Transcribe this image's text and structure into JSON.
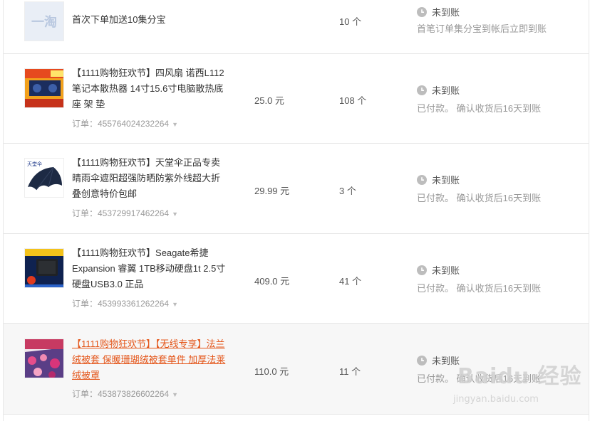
{
  "items": [
    {
      "title": "首次下单加送10集分宝",
      "order": "",
      "price": "",
      "quantity": "10 个",
      "status": "未到账",
      "status_note": "首笔订单集分宝到帐后立即到账",
      "thumb": "taobao-logo"
    },
    {
      "title": "【1111购物狂欢节】四风扇 诺西L112 笔记本散热器 14寸15.6寸电脑散热底座 架 垫",
      "order": "订单：455764024232264",
      "price": "25.0 元",
      "quantity": "108 个",
      "status": "未到账",
      "status_note": "已付款。 确认收货后16天到账",
      "thumb": "laptop-cooler"
    },
    {
      "title": "【1111购物狂欢节】天堂伞正品专卖晴雨伞遮阳超强防晒防紫外线超大折叠创意特价包邮",
      "order": "订单：453729917462264",
      "price": "29.99 元",
      "quantity": "3 个",
      "status": "未到账",
      "status_note": "已付款。 确认收货后16天到账",
      "thumb": "umbrella"
    },
    {
      "title": "【1111购物狂欢节】Seagate希捷 Expansion 睿翼 1TB移动硬盘1t 2.5寸硬盘USB3.0 正品",
      "order": "订单：453993361262264",
      "price": "409.0 元",
      "quantity": "41 个",
      "status": "未到账",
      "status_note": "已付款。 确认收货后16天到账",
      "thumb": "hard-drive"
    },
    {
      "title": "【1111购物狂欢节】【无线专享】法兰绒被套 保暖珊瑚绒被套单件 加厚法莱绒被罩",
      "order": "订单：453873826602264",
      "price": "110.0 元",
      "quantity": "11 个",
      "status": "未到账",
      "status_note": "已付款。 确认收货后16天到账",
      "thumb": "duvet-cover"
    }
  ],
  "thumb_text": {
    "taobao": "一淘",
    "umbrella_brand": "天堂伞"
  },
  "watermark": {
    "big": "Baidu 经验",
    "small": "jingyan.baidu.com"
  },
  "colors": {
    "link_orange": "#e4561a",
    "status_gray": "#999999",
    "hover_bg": "#f7f7f7"
  }
}
